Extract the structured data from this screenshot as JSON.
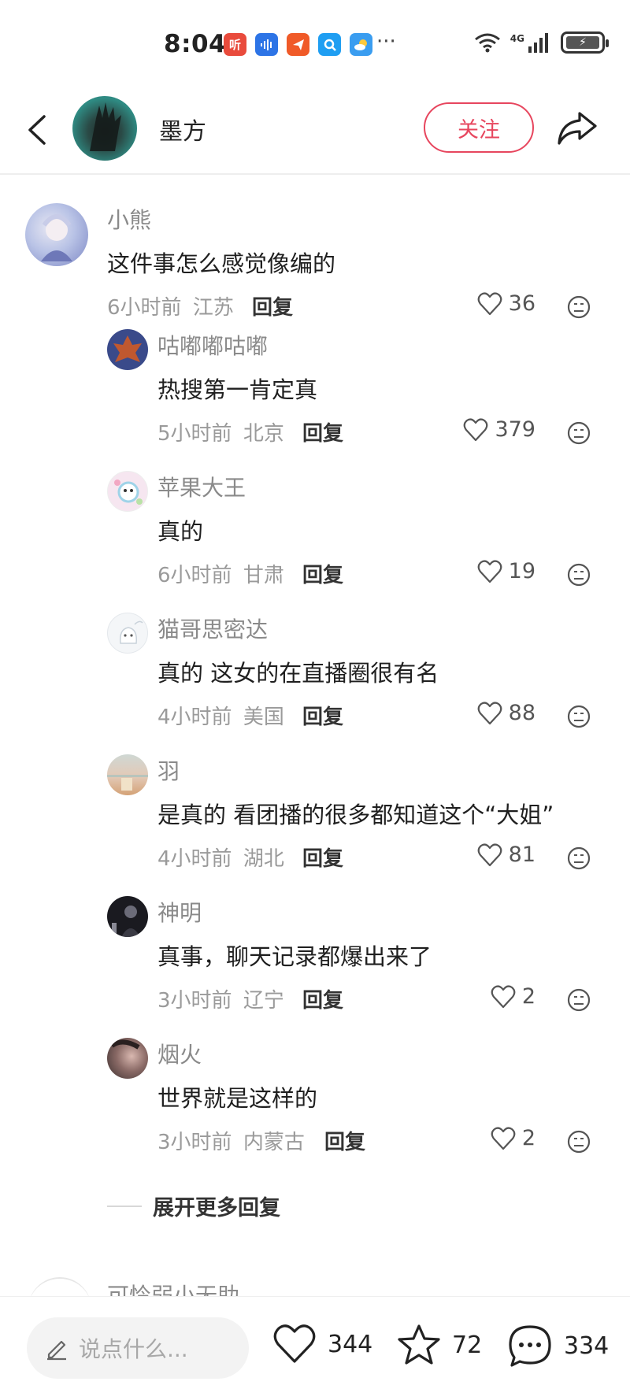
{
  "status": {
    "time": "8:04",
    "apps": [
      {
        "name": "listen-app-icon",
        "label": "听",
        "color": "#e94b3c"
      },
      {
        "name": "voice-app-icon",
        "label": "",
        "color": "#2d74e6"
      },
      {
        "name": "paper-plane-app-icon",
        "label": "",
        "color": "#f05a28"
      },
      {
        "name": "search-app-icon",
        "label": "",
        "color": "#1f9ef2"
      },
      {
        "name": "weather-app-icon",
        "label": "",
        "color": "#3a9df0"
      }
    ],
    "more": "···",
    "network": "4G"
  },
  "header": {
    "author_name": "墨方",
    "follow_label": "关注"
  },
  "comments": [
    {
      "user": "小熊",
      "text": "这件事怎么感觉像编的",
      "time": "6小时前",
      "location": "江苏",
      "reply": "回复",
      "likes": "36",
      "avatar_colors": [
        "#9aa9d6",
        "#e7e7f2"
      ]
    },
    {
      "user": "咕嘟嘟咕嘟",
      "text": "热搜第一肯定真",
      "time": "5小时前",
      "location": "北京",
      "reply": "回复",
      "likes": "379",
      "avatar_colors": [
        "#3a4a8a",
        "#c0582f"
      ]
    },
    {
      "user": "苹果大王",
      "text": "真的",
      "time": "6小时前",
      "location": "甘肃",
      "reply": "回复",
      "likes": "19",
      "avatar_colors": [
        "#f6e6f0",
        "#9fd3e8"
      ]
    },
    {
      "user": "猫哥思密达",
      "text": "真的 这女的在直播圈很有名",
      "time": "4小时前",
      "location": "美国",
      "reply": "回复",
      "likes": "88",
      "avatar_colors": [
        "#f4f6f8",
        "#d8e0e8"
      ]
    },
    {
      "user": "羽",
      "text": "是真的 看团播的很多都知道这个“大姐”",
      "time": "4小时前",
      "location": "湖北",
      "reply": "回复",
      "likes": "81",
      "avatar_colors": [
        "#cfd8d4",
        "#d4a276"
      ]
    },
    {
      "user": "神明",
      "text": "真事，聊天记录都爆出来了",
      "time": "3小时前",
      "location": "辽宁",
      "reply": "回复",
      "likes": "2",
      "avatar_colors": [
        "#1a1a20",
        "#6b6b78"
      ]
    },
    {
      "user": "烟火",
      "text": "世界就是这样的",
      "time": "3小时前",
      "location": "内蒙古",
      "reply": "回复",
      "likes": "2",
      "avatar_colors": [
        "#3a2e2e",
        "#d9b8b0"
      ]
    }
  ],
  "expand_label": "展开更多回复",
  "next_user": "可怜弱小无助",
  "bottom": {
    "placeholder": "说点什么...",
    "likes": "344",
    "favorites": "72",
    "comments": "334"
  }
}
